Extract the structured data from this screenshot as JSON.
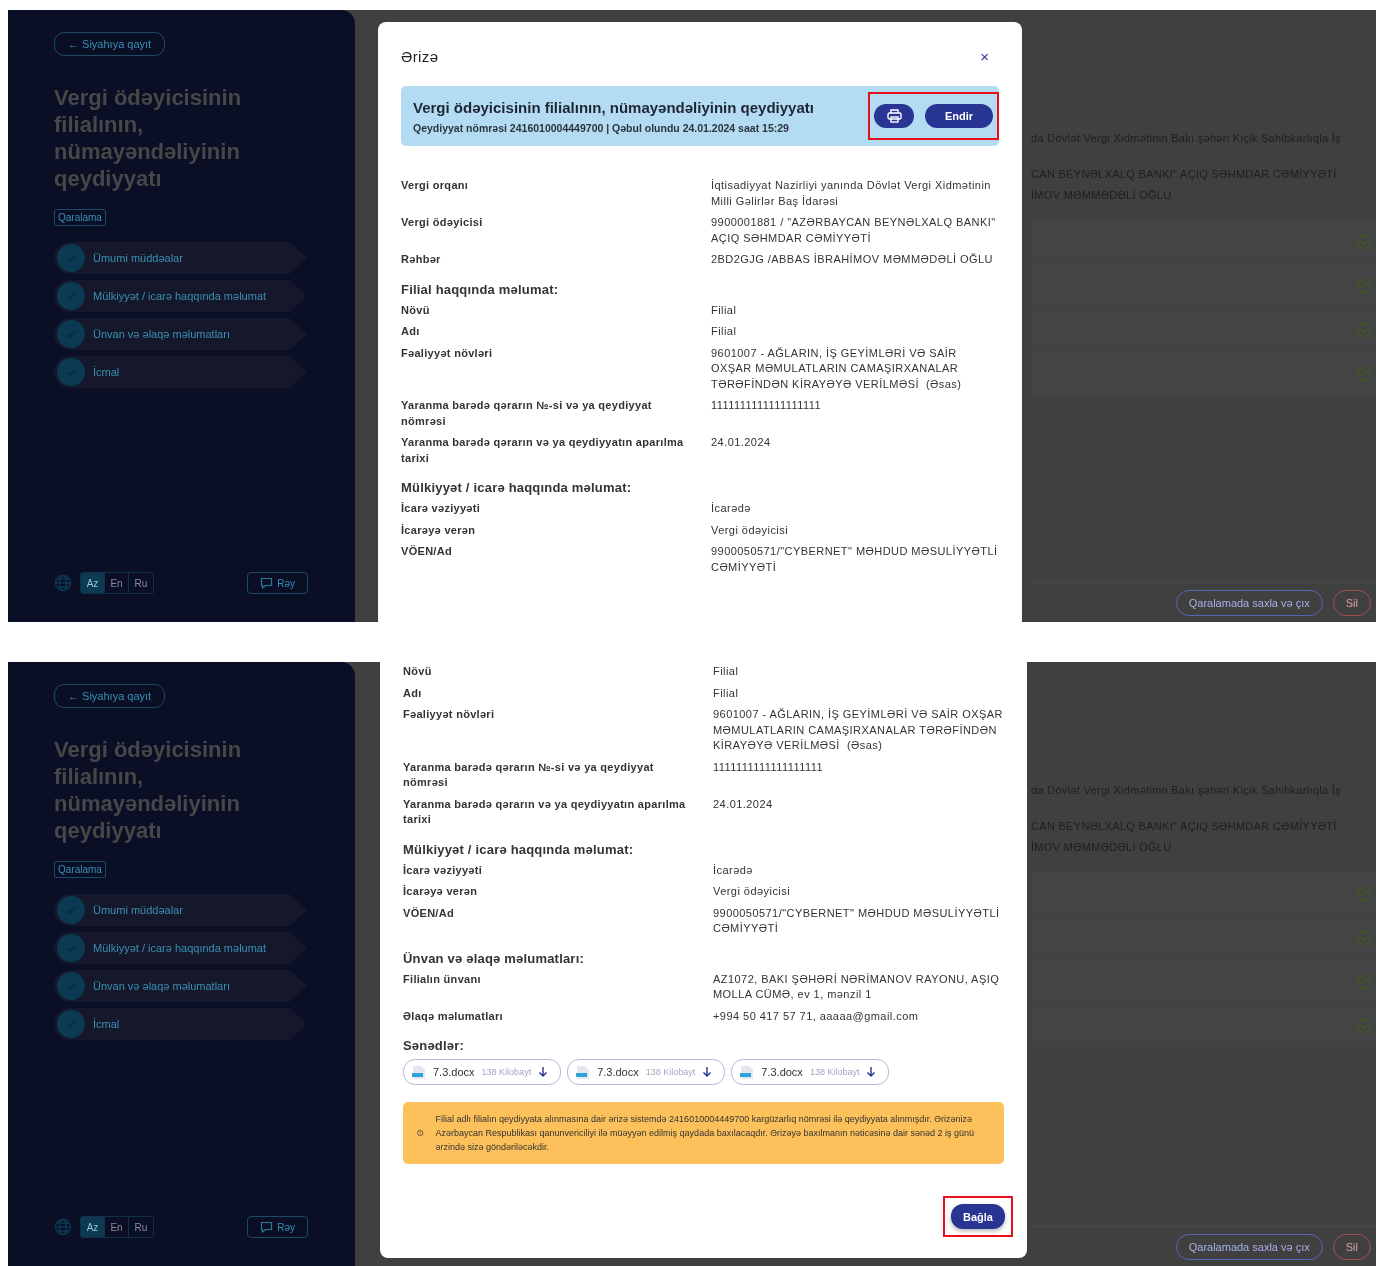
{
  "panels": [
    {
      "sidebar": {
        "back_button": "← Siyahıya qayıt",
        "title": "Vergi ödəyicisinin filialının, nümayəndəliyinin qeydiyyatı",
        "status_badge": "Qaralama",
        "steps": [
          {
            "label": "Ümumi müddəalar",
            "done": true
          },
          {
            "label": "Mülkiyyət / icarə haqqında məlumat",
            "done": true
          },
          {
            "label": "Ünvan və əlaqə məlumatları",
            "done": true
          },
          {
            "label": "İcmal",
            "done": true
          }
        ],
        "languages": [
          {
            "label": "Az",
            "selected": true
          },
          {
            "label": "En",
            "selected": false
          },
          {
            "label": "Ru",
            "selected": false
          }
        ],
        "feedback_button": "Rəy"
      },
      "main": {
        "lines": [
          "da Dövlət Vergi Xidmətinin Bakı şəhəri Kiçik Sahibkarlıqla İş",
          "CAN BEYNƏLXALQ BANKI\" AÇIQ SƏHMDAR CƏMİYYƏTİ",
          "İMOV MƏMMƏDƏLİ OĞLU"
        ],
        "rows": [
          {
            "done": true
          },
          {
            "done": true
          },
          {
            "done": true
          },
          {
            "done": true
          }
        ],
        "buttons": [
          {
            "label": "Qaralamada saxla və çıx",
            "kind": "primary"
          },
          {
            "label": "Sil",
            "kind": "danger"
          }
        ]
      },
      "modal": {
        "title": "Ərizə",
        "close": "×",
        "banner": {
          "title": "Vergi ödəyicisinin filialının, nümayəndəliyinin qeydiyyatı",
          "subtitle": "Qeydiyyat nömrəsi 2416010004449700 | Qəbul olundu 24.01.2024 saat 15:29",
          "download_button": "Endir",
          "highlighted": true
        },
        "blocks": [
          {
            "kind": "row",
            "label": "Vergi orqanı",
            "value": "İqtisadiyyat Nazirliyi yanında Dövlət Vergi Xidmətinin Milli Gəlirlər Baş İdarəsi"
          },
          {
            "kind": "row",
            "label": "Vergi ödəyicisi",
            "value": "9900001881 / \"AZƏRBAYCAN BEYNƏLXALQ BANKI\" AÇIQ SƏHMDAR CƏMİYYƏTİ"
          },
          {
            "kind": "row",
            "label": "Rəhbər",
            "value": "2BD2GJG /ABBAS İBRAHİMOV MƏMMƏDƏLİ OĞLU"
          },
          {
            "kind": "heading",
            "label": "Filial haqqında məlumat:"
          },
          {
            "kind": "row",
            "label": "Növü",
            "value": "Filial"
          },
          {
            "kind": "row",
            "label": "Adı",
            "value": "Filial"
          },
          {
            "kind": "row",
            "label": "Fəaliyyət növləri",
            "value": "9601007 - AĞLARIN, İŞ GEYİMLƏRİ VƏ SAİR OXŞAR MƏMULATLARIN CAMAŞIRXANALAR TƏRƏFİNDƏN KİRAYƏYƏ VERİLMƏSİ  (Əsas)"
          },
          {
            "kind": "row",
            "label": "Yaranma barədə qərarın №-si və ya qeydiyyat nömrəsi",
            "value": "1111111111111111111"
          },
          {
            "kind": "row",
            "label": "Yaranma barədə qərarın və ya qeydiyyatın aparılma tarixi",
            "value": "24.01.2024"
          },
          {
            "kind": "heading",
            "label": "Mülkiyyət / icarə haqqında məlumat:"
          },
          {
            "kind": "row",
            "label": "İcarə vəziyyəti",
            "value": "İcarədə"
          },
          {
            "kind": "row",
            "label": "İcarəyə verən",
            "value": "Vergi ödəyicisi"
          },
          {
            "kind": "row",
            "label": "VÖEN/Ad",
            "value": "9900050571/\"CYBERNET\" MƏHDUD MƏSULİYYƏTLİ CƏMİYYƏTİ"
          }
        ]
      }
    },
    {
      "sidebar": {
        "back_button": "← Siyahıya qayıt",
        "title": "Vergi ödəyicisinin filialının, nümayəndəliyinin qeydiyyatı",
        "status_badge": "Qaralama",
        "steps": [
          {
            "label": "Ümumi müddəalar",
            "done": true
          },
          {
            "label": "Mülkiyyət / icarə haqqında məlumat",
            "done": true
          },
          {
            "label": "Ünvan və əlaqə məlumatları",
            "done": true
          },
          {
            "label": "İcmal",
            "done": true
          }
        ],
        "languages": [
          {
            "label": "Az",
            "selected": true
          },
          {
            "label": "En",
            "selected": false
          },
          {
            "label": "Ru",
            "selected": false
          }
        ],
        "feedback_button": "Rəy"
      },
      "main": {
        "lines": [
          "da Dövlət Vergi Xidmətinin Bakı şəhəri Kiçik Sahibkarlıqla İş",
          "CAN BEYNƏLXALQ BANKI\" AÇIQ SƏHMDAR CƏMİYYƏTİ",
          "İMOV MƏMMƏDƏLİ OĞLU"
        ],
        "rows": [
          {
            "done": true
          },
          {
            "done": true
          },
          {
            "done": true
          },
          {
            "done": true
          }
        ],
        "buttons": [
          {
            "label": "Qaralamada saxla və çıx",
            "kind": "primary"
          },
          {
            "label": "Sil",
            "kind": "danger"
          }
        ]
      },
      "modal": {
        "blocks": [
          {
            "kind": "row",
            "label": "Növü",
            "value": "Filial"
          },
          {
            "kind": "row",
            "label": "Adı",
            "value": "Filial"
          },
          {
            "kind": "row",
            "label": "Fəaliyyət növləri",
            "value": "9601007 - AĞLARIN, İŞ GEYİMLƏRİ VƏ SAİR OXŞAR MƏMULATLARIN CAMAŞIRXANALAR TƏRƏFİNDƏN KİRAYƏYƏ VERİLMƏSİ  (Əsas)"
          },
          {
            "kind": "row",
            "label": "Yaranma barədə qərarın №-si və ya qeydiyyat nömrəsi",
            "value": "1111111111111111111"
          },
          {
            "kind": "row",
            "label": "Yaranma barədə qərarın və ya qeydiyyatın aparılma tarixi",
            "value": "24.01.2024"
          },
          {
            "kind": "heading",
            "label": "Mülkiyyət / icarə haqqında məlumat:"
          },
          {
            "kind": "row",
            "label": "İcarə vəziyyəti",
            "value": "İcarədə"
          },
          {
            "kind": "row",
            "label": "İcarəyə verən",
            "value": "Vergi ödəyicisi"
          },
          {
            "kind": "row",
            "label": "VÖEN/Ad",
            "value": "9900050571/\"CYBERNET\" MƏHDUD MƏSULİYYƏTLİ CƏMİYYƏTİ"
          },
          {
            "kind": "heading",
            "label": "Ünvan və əlaqə məlumatları:"
          },
          {
            "kind": "row",
            "label": "Filialın ünvanı",
            "value": "AZ1072, BAKI ŞƏHƏRİ NƏRİMANOV RAYONU, AŞIQ MOLLA CÜMƏ, ev 1, mənzil 1"
          },
          {
            "kind": "row",
            "label": "Əlaqə məlumatları",
            "value": "+994 50 417 57 71, aaaaa@gmail.com"
          },
          {
            "kind": "heading",
            "label": "Sənədlər:"
          }
        ],
        "documents": [
          {
            "name": "7.3.docx",
            "size": "138 Kilobayt"
          },
          {
            "name": "7.3.docx",
            "size": "138 Kilobayt"
          },
          {
            "name": "7.3.docx",
            "size": "138 Kilobayt"
          }
        ],
        "notice": "Filial adlı filialın qeydiyyata alınmasına dair ərizə sistemdə 2416010004449700 kargüzarlıq nömrəsi ilə qeydiyyata alınmışdır. Ərizənizə Azərbaycan Respublikası qanunvericiliyi ilə müəyyən edilmiş qaydada baxılacaqdır. Ərizəyə baxılmanın nəticəsinə dair sənəd 2 iş günü ərzində sizə göndəriləcəkdir.",
        "footer": {
          "close_button": "Bağla",
          "highlighted": true
        }
      }
    }
  ]
}
